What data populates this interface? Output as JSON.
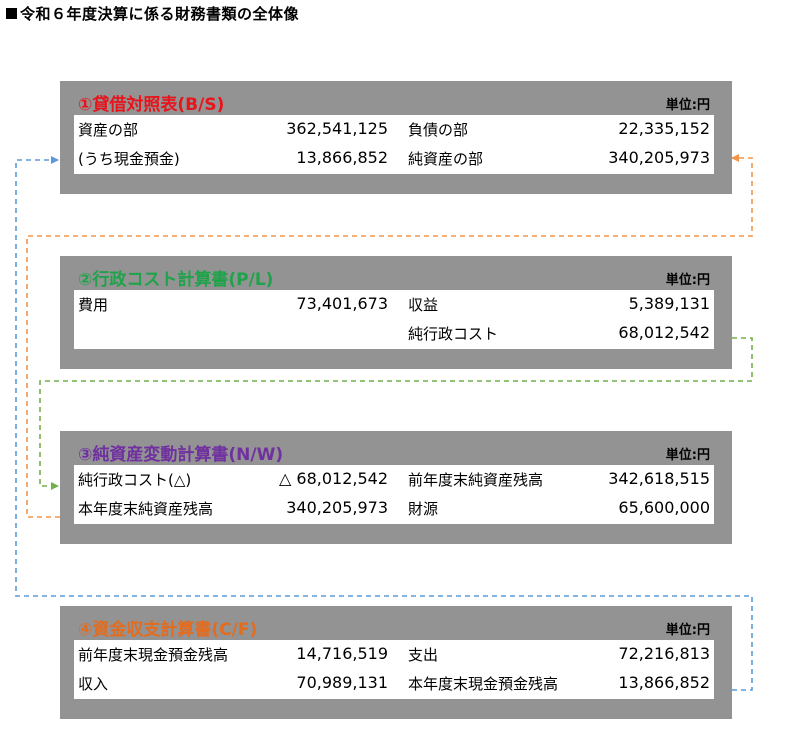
{
  "title": "令和６年度決算に係る財務書類の全体像",
  "colors": {
    "panel_bg": "#939393",
    "bs": "#e8141c",
    "pl": "#1fa34a",
    "nw": "#7030a0",
    "cf": "#e36c1f",
    "link_blue": "#5b9bd5",
    "link_orange": "#f0954a",
    "link_green": "#70b14a"
  },
  "panels": [
    {
      "id": "bs",
      "title": "①貸借対照表(B/S)",
      "unit": "単位:円",
      "rows": [
        {
          "label1": "資産の部",
          "value1": "362,541,125",
          "label2": "負債の部",
          "value2": "22,335,152"
        },
        {
          "label1": "(うち現金預金)",
          "value1": "13,866,852",
          "label2": "純資産の部",
          "value2": "340,205,973"
        }
      ]
    },
    {
      "id": "pl",
      "title": "②行政コスト計算書(P/L)",
      "unit": "単位:円",
      "rows": [
        {
          "label1": "費用",
          "value1": "73,401,673",
          "label2": "収益",
          "value2": "5,389,131"
        },
        {
          "label1": "",
          "value1": "",
          "label2": "純行政コスト",
          "value2": "68,012,542"
        }
      ]
    },
    {
      "id": "nw",
      "title": "③純資産変動計算書(N/W)",
      "unit": "単位:円",
      "rows": [
        {
          "label1": "純行政コスト(△)",
          "value1": "△ 68,012,542",
          "label2": "前年度末純資産残高",
          "value2": "342,618,515"
        },
        {
          "label1": "本年度末純資産残高",
          "value1": "340,205,973",
          "label2": "財源",
          "value2": "65,600,000"
        }
      ]
    },
    {
      "id": "cf",
      "title": "④資金収支計算書(C/F)",
      "unit": "単位:円",
      "rows": [
        {
          "label1": "前年度末現金預金残高",
          "value1": "14,716,519",
          "label2": "支出",
          "value2": "72,216,813"
        },
        {
          "label1": "収入",
          "value1": "70,989,131",
          "label2": "本年度末現金預金残高",
          "value2": "13,866,852"
        }
      ]
    }
  ]
}
